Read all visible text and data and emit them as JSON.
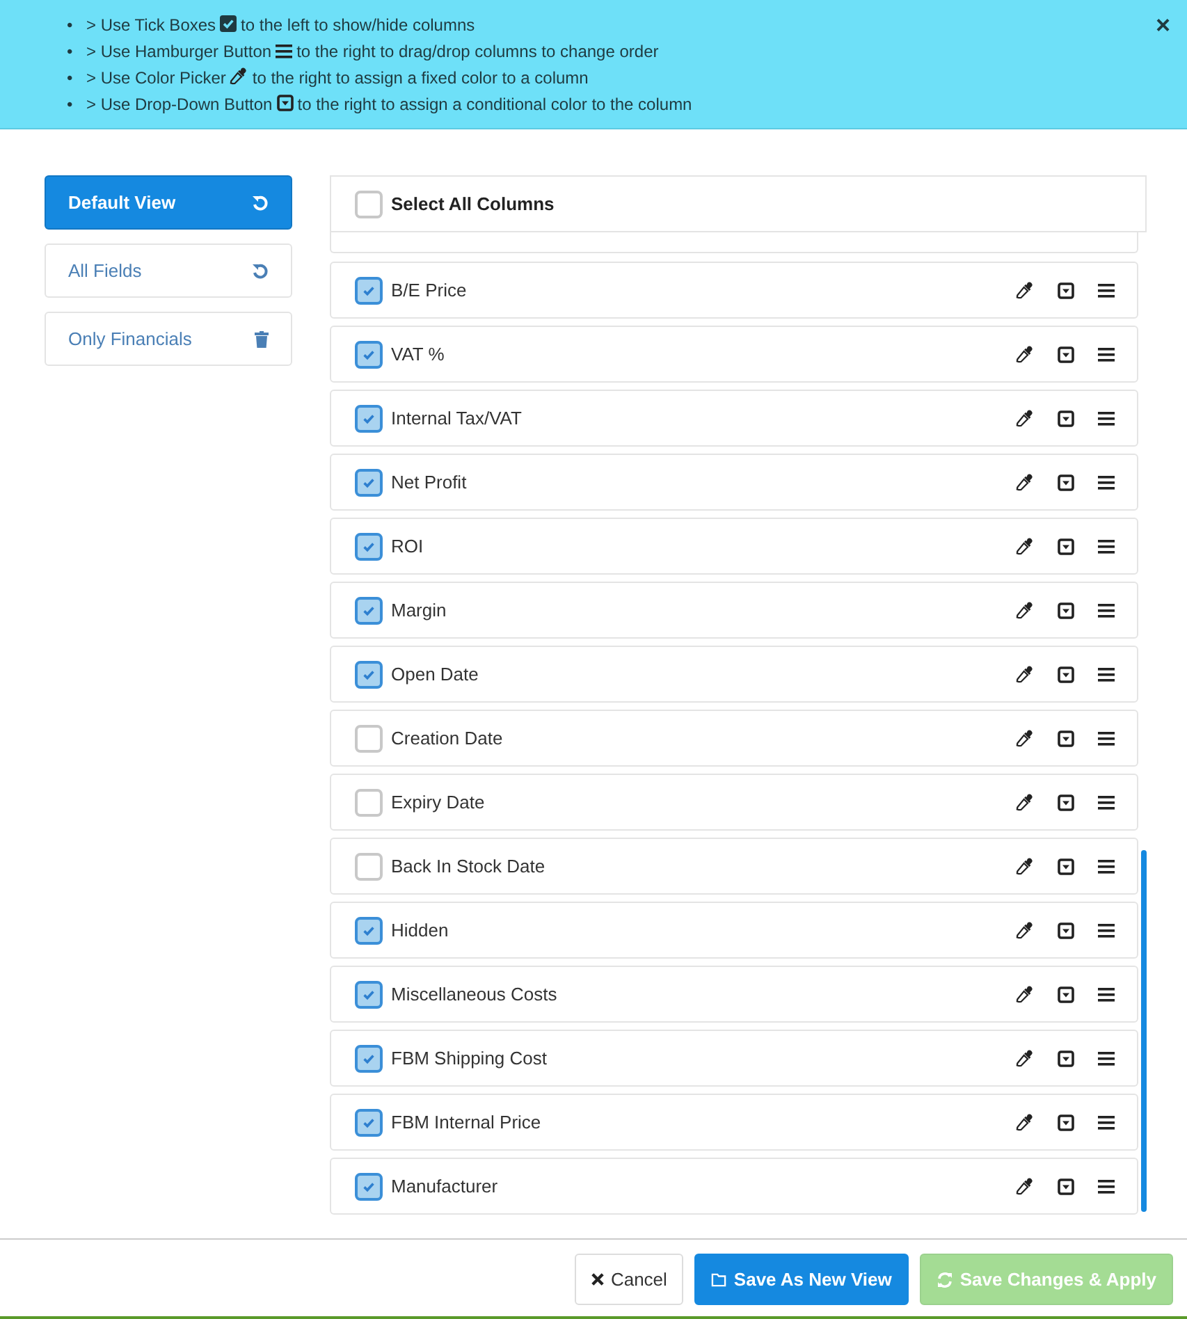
{
  "banner": {
    "items": [
      {
        "bullet": "•",
        "before": "> Use Tick Boxes",
        "kind": "tick",
        "after": "to the left to show/hide columns"
      },
      {
        "bullet": "•",
        "before": "> Use Hamburger Button",
        "kind": "hamburger",
        "after": "to the right to drag/drop columns to change order"
      },
      {
        "bullet": "•",
        "before": "> Use Color Picker",
        "kind": "picker",
        "after": "to the right to assign a fixed color to a column"
      },
      {
        "bullet": "•",
        "before": "> Use Drop-Down Button",
        "kind": "dropdown",
        "after": "to the right to assign a conditional color to the column"
      }
    ],
    "close": "×"
  },
  "views": [
    {
      "label": "Default View",
      "selected": true,
      "kind": "reset"
    },
    {
      "label": "All Fields",
      "selected": false,
      "kind": "reset"
    },
    {
      "label": "Only Financials",
      "selected": false,
      "kind": "delete"
    }
  ],
  "select_all": {
    "label": "Select All Columns",
    "checked": false
  },
  "columns": [
    {
      "label": "B/E Price",
      "checked": true
    },
    {
      "label": "VAT %",
      "checked": true
    },
    {
      "label": "Internal Tax/VAT",
      "checked": true
    },
    {
      "label": "Net Profit",
      "checked": true
    },
    {
      "label": "ROI",
      "checked": true
    },
    {
      "label": "Margin",
      "checked": true
    },
    {
      "label": "Open Date",
      "checked": true
    },
    {
      "label": "Creation Date",
      "checked": false
    },
    {
      "label": "Expiry Date",
      "checked": false
    },
    {
      "label": "Back In Stock Date",
      "checked": false
    },
    {
      "label": "Hidden",
      "checked": true
    },
    {
      "label": "Miscellaneous Costs",
      "checked": true
    },
    {
      "label": "FBM Shipping Cost",
      "checked": true
    },
    {
      "label": "FBM Internal Price",
      "checked": true
    },
    {
      "label": "Manufacturer",
      "checked": true
    }
  ],
  "footer": {
    "buttons": [
      {
        "label": "Cancel",
        "kind": "cancel",
        "disabled": false
      },
      {
        "label": "Save As New View",
        "kind": "primary",
        "disabled": false
      },
      {
        "label": "Save Changes & Apply",
        "kind": "apply",
        "disabled": true
      }
    ]
  }
}
